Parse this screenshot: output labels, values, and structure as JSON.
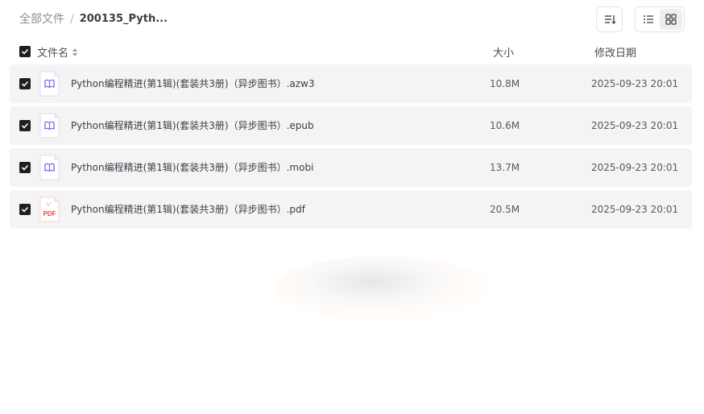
{
  "breadcrumb": {
    "root": "全部文件",
    "separator": "/",
    "current": "200135_Pyth..."
  },
  "toolbar": {
    "sort_icon": "sort-icon",
    "list_view_icon": "list-view-icon",
    "grid_view_icon": "grid-view-icon",
    "active_view": "list"
  },
  "table": {
    "columns": {
      "name": "文件名",
      "size": "大小",
      "date": "修改日期"
    },
    "rows": [
      {
        "name": "Python编程精进(第1辑)(套装共3册)（异步图书）.azw3",
        "size": "10.8M",
        "date": "2025-09-23 20:01",
        "type": "ebook",
        "checked": true
      },
      {
        "name": "Python编程精进(第1辑)(套装共3册)（异步图书）.epub",
        "size": "10.6M",
        "date": "2025-09-23 20:01",
        "type": "ebook",
        "checked": true
      },
      {
        "name": "Python编程精进(第1辑)(套装共3册)（异步图书）.mobi",
        "size": "13.7M",
        "date": "2025-09-23 20:01",
        "type": "ebook",
        "checked": true
      },
      {
        "name": "Python编程精进(第1辑)(套装共3册)（异步图书）.pdf",
        "size": "20.5M",
        "date": "2025-09-23 20:01",
        "type": "pdf",
        "checked": true
      }
    ]
  },
  "icons": {
    "pdf_label": "PDF"
  },
  "colors": {
    "row_bg": "#f4f4f5",
    "checkbox": "#1f1f1f",
    "ebook_icon": "#7b6cf0",
    "pdf_icon": "#e8473c"
  }
}
